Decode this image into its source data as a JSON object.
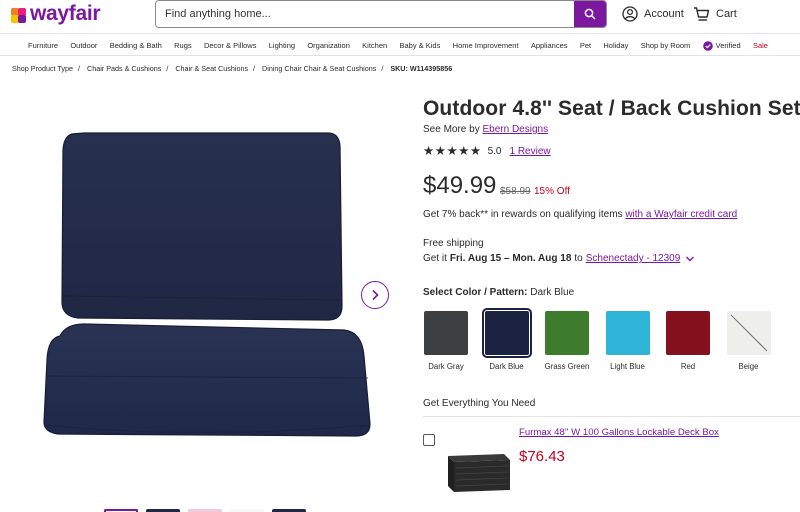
{
  "brand": {
    "name": "wayfair",
    "color": "#7b189f"
  },
  "search": {
    "placeholder": "Find anything home..."
  },
  "header": {
    "account_label": "Account",
    "cart_label": "Cart"
  },
  "nav": {
    "categories": [
      "Furniture",
      "Outdoor",
      "Bedding & Bath",
      "Rugs",
      "Decor & Pillows",
      "Lighting",
      "Organization",
      "Kitchen",
      "Baby & Kids",
      "Home Improvement",
      "Appliances",
      "Pet",
      "Holiday",
      "Shop by Room"
    ],
    "verified_label": "Verified",
    "sale_label": "Sale"
  },
  "breadcrumb": {
    "items": [
      "Shop Product Type",
      "Chair Pads & Cushions",
      "Chair & Seat Cushions",
      "Dining Chair Chair & Seat Cushions"
    ],
    "sku": "SKU: W114395856"
  },
  "product": {
    "title": "Outdoor 4.8'' Seat / Back Cushion Set",
    "see_more_prefix": "See More by",
    "brand_link": "Ebern Designs",
    "rating_value": "5.0",
    "stars": 5,
    "reviews_link": "1 Review",
    "price": "$49.99",
    "was_price": "$58.99",
    "discount": "15% Off",
    "rewards_text": "Get 7% back** in rewards on qualifying items",
    "rewards_link": "with a Wayfair credit card",
    "shipping": "Free shipping",
    "delivery_prefix": "Get it",
    "delivery_dates": "Fri. Aug 15 – Mon. Aug 18",
    "delivery_to": "to",
    "delivery_location": "Schenectady - 12309",
    "color_label": "Select Color / Pattern:",
    "color_selected": "Dark Blue"
  },
  "swatches": [
    {
      "name": "Dark Gray",
      "color": "#3e3f40",
      "selected": false
    },
    {
      "name": "Dark Blue",
      "color": "#1c2340",
      "selected": true
    },
    {
      "name": "Grass Green",
      "color": "#3c7c2c",
      "selected": false
    },
    {
      "name": "Light Blue",
      "color": "#2fb3d6",
      "selected": false
    },
    {
      "name": "Red",
      "color": "#85111f",
      "selected": false
    },
    {
      "name": "Beige",
      "color": "#eeeeec",
      "selected": false
    }
  ],
  "bundle": {
    "heading": "Get Everything You Need",
    "item_name": "Furmax 48'' W 100 Gallons Lockable Deck Box",
    "item_price": "$76.43"
  },
  "colors": {
    "accent": "#7b189f",
    "sale_red": "#c4001f",
    "cushion_navy": "#232b48"
  }
}
